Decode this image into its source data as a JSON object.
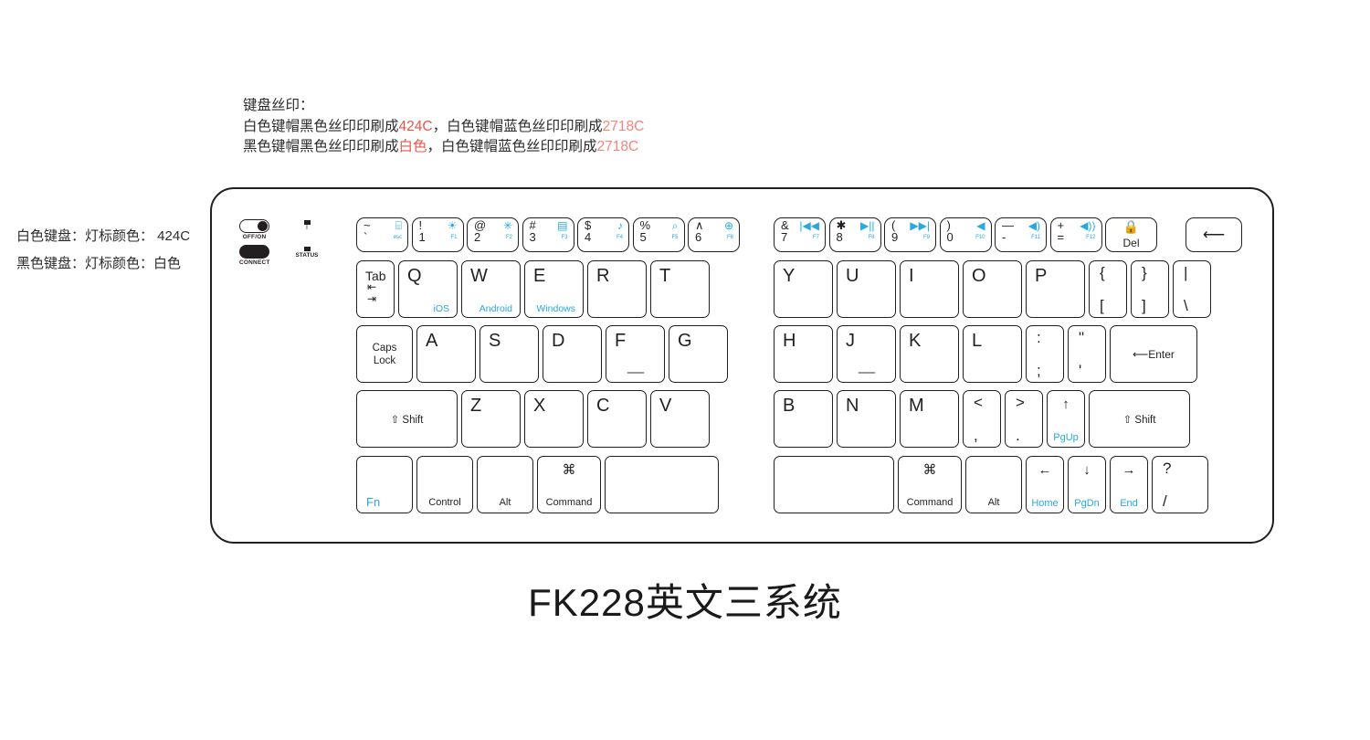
{
  "spec_note": {
    "line1": "键盘丝印：",
    "line2_a": "白色键帽黑色丝印印刷成",
    "line2_code": "424C",
    "line2_b": "，白色键帽蓝色丝印印刷成",
    "line2_code2": "2718C",
    "line3_a": "黑色键帽黑色丝印印刷成",
    "line3_code": "白色",
    "line3_b": "，白色键帽蓝色丝印印刷成",
    "line3_code2": "2718C"
  },
  "left_note": {
    "line1": "白色键盘：灯标颜色：  424C",
    "line2": "黑色键盘：灯标颜色：白色"
  },
  "controls": {
    "power_label": "OFF/ON",
    "connect_label": "CONNECT",
    "status_label": "STATUS",
    "battery_label": "I"
  },
  "title": "FK228英文三系统",
  "colors": {
    "ink_black": "#231f20",
    "ink_blue": "#29a9e0",
    "accent_red": "#e8564a"
  },
  "rows": {
    "fn_row_left": [
      {
        "top": "~",
        "bottom": "`",
        "icon": "⌸",
        "fkey": "esc",
        "fkey_blue": true
      },
      {
        "top": "!",
        "bottom": "1",
        "icon": "☀",
        "fkey": "F1"
      },
      {
        "top": "@",
        "bottom": "2",
        "icon": "✳",
        "fkey": "F2"
      },
      {
        "top": "#",
        "bottom": "3",
        "icon": "▤",
        "fkey": "F3"
      },
      {
        "top": "$",
        "bottom": "4",
        "icon": "♪",
        "fkey": "F4"
      },
      {
        "top": "%",
        "bottom": "5",
        "icon": "⌕",
        "fkey": "F5"
      },
      {
        "top": "∧",
        "bottom": "6",
        "icon": "⊕",
        "fkey": "F6"
      }
    ],
    "fn_row_right": [
      {
        "top": "&",
        "bottom": "7",
        "icon": "|◀◀",
        "fkey": "F7"
      },
      {
        "top": "✱",
        "bottom": "8",
        "icon": "▶||",
        "fkey": "F8"
      },
      {
        "top": "(",
        "bottom": "9",
        "icon": "▶▶|",
        "fkey": "F9"
      },
      {
        "top": ")",
        "bottom": "0",
        "icon": "◀",
        "fkey": "F10"
      },
      {
        "top": "—",
        "bottom": "-",
        "icon": "◀)",
        "fkey": "F11"
      },
      {
        "top": "+",
        "bottom": "=",
        "icon": "◀))",
        "fkey": "F12"
      }
    ],
    "del_key": {
      "icon": "lock-icon",
      "label": "Del"
    },
    "backspace": {
      "glyph": "⟵"
    },
    "qwerty_left": [
      {
        "label": "Tab",
        "type": "tab"
      },
      {
        "label": "Q",
        "sub": "iOS"
      },
      {
        "label": "W",
        "sub": "Android"
      },
      {
        "label": "E",
        "sub": "Windows"
      },
      {
        "label": "R"
      },
      {
        "label": "T"
      }
    ],
    "qwerty_right": [
      {
        "label": "Y"
      },
      {
        "label": "U"
      },
      {
        "label": "I"
      },
      {
        "label": "O"
      },
      {
        "label": "P"
      },
      {
        "top": "{",
        "bottom": "["
      },
      {
        "top": "}",
        "bottom": "]"
      },
      {
        "top": "|",
        "bottom": "\\"
      }
    ],
    "home_left": [
      {
        "label": "Caps\nLock",
        "l1": "Caps",
        "l2": "Lock",
        "type": "caps"
      },
      {
        "label": "A"
      },
      {
        "label": "S"
      },
      {
        "label": "D"
      },
      {
        "label": "F",
        "homing": true
      },
      {
        "label": "G"
      }
    ],
    "home_right": [
      {
        "label": "H"
      },
      {
        "label": "J",
        "homing": true
      },
      {
        "label": "K"
      },
      {
        "label": "L"
      },
      {
        "top": ":",
        "bottom": ";"
      },
      {
        "top": "\"",
        "bottom": "'"
      },
      {
        "label": "Enter",
        "glyph": "⟵⏎",
        "type": "enter"
      }
    ],
    "shift_left": [
      {
        "label": "⇧ Shift",
        "type": "shift"
      },
      {
        "label": "Z"
      },
      {
        "label": "X"
      },
      {
        "label": "C"
      },
      {
        "label": "V"
      }
    ],
    "shift_right": [
      {
        "label": "B"
      },
      {
        "label": "N"
      },
      {
        "label": "M"
      },
      {
        "top": "<",
        "bottom": ","
      },
      {
        "top": ">",
        "bottom": "."
      },
      {
        "arrow": "↑",
        "nav": "PgUp"
      },
      {
        "label": "⇧ Shift",
        "type": "shift"
      }
    ],
    "bottom_left": [
      {
        "label": "Fn",
        "blue": true
      },
      {
        "label": "Control"
      },
      {
        "label": "Alt"
      },
      {
        "label": "Command",
        "icon": "⌘"
      },
      {
        "label": "",
        "type": "space"
      }
    ],
    "bottom_right": [
      {
        "label": "",
        "type": "space"
      },
      {
        "label": "Command",
        "icon": "⌘"
      },
      {
        "label": "Alt"
      },
      {
        "arrow": "←",
        "nav": "Home"
      },
      {
        "arrow": "↓",
        "nav": "PgDn"
      },
      {
        "arrow": "→",
        "nav": "End"
      },
      {
        "top": "?",
        "bottom": "/"
      }
    ]
  }
}
